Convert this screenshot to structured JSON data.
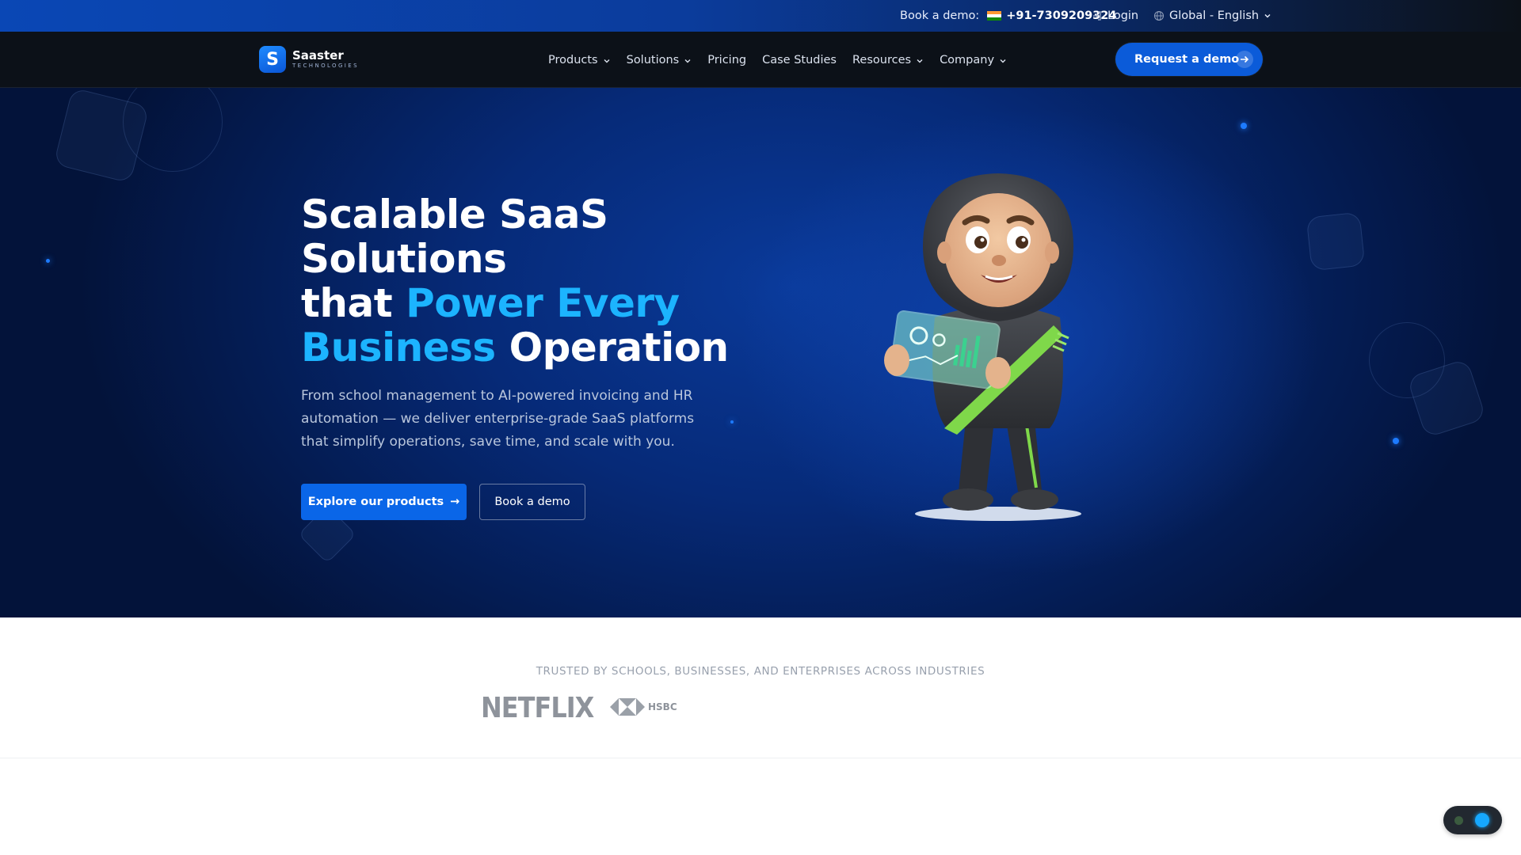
{
  "topbar": {
    "demo_label": "Book a demo:",
    "phone": "+91-7309209324",
    "login": "Login",
    "language": "Global - English"
  },
  "nav": {
    "logo_mark": "S",
    "logo_name": "Saaster",
    "logo_sub": "TECHNOLOGIES",
    "links": [
      {
        "label": "Products",
        "dropdown": true
      },
      {
        "label": "Solutions",
        "dropdown": true
      },
      {
        "label": "Pricing",
        "dropdown": false
      },
      {
        "label": "Case Studies",
        "dropdown": false
      },
      {
        "label": "Resources",
        "dropdown": true
      },
      {
        "label": "Company",
        "dropdown": true
      }
    ],
    "cta": "Request a demo"
  },
  "hero": {
    "title_line1": "Scalable SaaS Solutions",
    "title_that": "that",
    "title_accent": "Power Every Business",
    "title_end": "Operation",
    "subtitle": "From school management to AI-powered invoicing and HR automation — we deliver enterprise-grade SaaS platforms that simplify operations, save time, and scale with you.",
    "primary_button": "Explore our products",
    "primary_arrow": "→",
    "secondary_button": "Book a demo"
  },
  "trusted": {
    "label": "TRUSTED BY SCHOOLS, BUSINESSES, AND ENTERPRISES ACROSS INDUSTRIES",
    "logos": [
      "NETFLIX",
      "HSBC"
    ]
  },
  "colors": {
    "accent": "#1cb4ff",
    "primary": "#0a66e8",
    "nav_bg": "#0c1118"
  }
}
